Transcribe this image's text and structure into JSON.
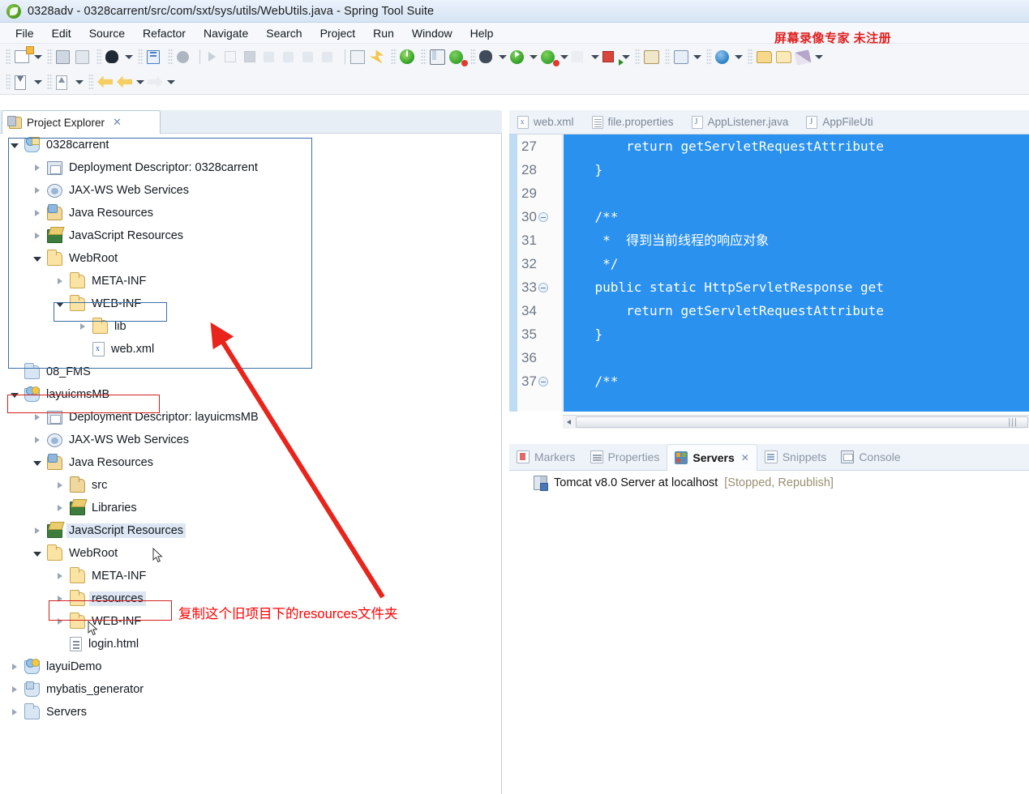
{
  "window": {
    "title": "0328adv - 0328carrent/src/com/sxt/sys/utils/WebUtils.java - Spring Tool Suite",
    "logo_icon": "spring-logo-icon"
  },
  "menubar": {
    "items": [
      {
        "label": "File"
      },
      {
        "label": "Edit"
      },
      {
        "label": "Source"
      },
      {
        "label": "Refactor"
      },
      {
        "label": "Navigate"
      },
      {
        "label": "Search"
      },
      {
        "label": "Project"
      },
      {
        "label": "Run"
      },
      {
        "label": "Window"
      },
      {
        "label": "Help"
      }
    ]
  },
  "watermark": {
    "text": "屏幕录像专家 未注册",
    "color": "#e02020"
  },
  "project_explorer": {
    "tab_label": "Project Explorer",
    "tab_close": "✕",
    "toolbar": [
      {
        "icon": "collapse-all-icon"
      },
      {
        "icon": "link-with-editor-icon"
      },
      {
        "icon": "view-menu-dim-icon"
      },
      {
        "icon": "view-menu-icon"
      },
      {
        "icon": "minimize-icon"
      },
      {
        "icon": "maximize-icon"
      }
    ],
    "tree": [
      {
        "label": "0328carrent",
        "depth": 0,
        "twisty": "open",
        "icon": "project-icon"
      },
      {
        "label": "Deployment Descriptor: 0328carrent",
        "depth": 1,
        "twisty": "closed",
        "icon": "deployment-descriptor-icon"
      },
      {
        "label": "JAX-WS Web Services",
        "depth": 1,
        "twisty": "closed",
        "icon": "jaxws-icon"
      },
      {
        "label": "Java Resources",
        "depth": 1,
        "twisty": "closed",
        "icon": "java-resources-icon"
      },
      {
        "label": "JavaScript Resources",
        "depth": 1,
        "twisty": "closed",
        "icon": "javascript-resources-icon"
      },
      {
        "label": "WebRoot",
        "depth": 1,
        "twisty": "open",
        "icon": "folder-icon"
      },
      {
        "label": "META-INF",
        "depth": 2,
        "twisty": "closed",
        "icon": "folder-icon"
      },
      {
        "label": "WEB-INF",
        "depth": 2,
        "twisty": "open",
        "icon": "folder-icon"
      },
      {
        "label": "lib",
        "depth": 3,
        "twisty": "closed",
        "icon": "folder-icon"
      },
      {
        "label": "web.xml",
        "depth": 3,
        "twisty": "none",
        "icon": "xml-file-icon"
      },
      {
        "label": "08_FMS",
        "depth": 0,
        "twisty": "none",
        "icon": "folder-plain-icon"
      },
      {
        "label": "layuicmsMB",
        "depth": 0,
        "twisty": "open",
        "icon": "project-warning-icon"
      },
      {
        "label": "Deployment Descriptor: layuicmsMB",
        "depth": 1,
        "twisty": "closed",
        "icon": "deployment-descriptor-icon"
      },
      {
        "label": "JAX-WS Web Services",
        "depth": 1,
        "twisty": "closed",
        "icon": "jaxws-icon"
      },
      {
        "label": "Java Resources",
        "depth": 1,
        "twisty": "open",
        "icon": "java-resources-icon"
      },
      {
        "label": "src",
        "depth": 2,
        "twisty": "closed",
        "icon": "source-folder-icon"
      },
      {
        "label": "Libraries",
        "depth": 2,
        "twisty": "closed",
        "icon": "javascript-resources-icon"
      },
      {
        "label": "JavaScript Resources",
        "depth": 1,
        "twisty": "closed",
        "icon": "javascript-resources-icon",
        "selected": true
      },
      {
        "label": "WebRoot",
        "depth": 1,
        "twisty": "open",
        "icon": "folder-icon"
      },
      {
        "label": "META-INF",
        "depth": 2,
        "twisty": "closed",
        "icon": "folder-icon"
      },
      {
        "label": "resources",
        "depth": 2,
        "twisty": "closed",
        "icon": "folder-icon",
        "selected": true
      },
      {
        "label": "WEB-INF",
        "depth": 2,
        "twisty": "closed",
        "icon": "folder-icon"
      },
      {
        "label": "login.html",
        "depth": 2,
        "twisty": "none",
        "icon": "html-file-icon"
      },
      {
        "label": "layuiDemo",
        "depth": 0,
        "twisty": "closed",
        "icon": "project-warning-icon"
      },
      {
        "label": "mybatis_generator",
        "depth": 0,
        "twisty": "closed",
        "icon": "mybatis-project-icon"
      },
      {
        "label": "Servers",
        "depth": 0,
        "twisty": "closed",
        "icon": "servers-folder-icon"
      }
    ]
  },
  "annotations": {
    "note_text": "复制这个旧项目下的resources文件夹",
    "note_color": "#ff0000",
    "blue_box_color": "#3a6ea5",
    "red_box_color": "#d21f1f",
    "arrow_color": "#e8241b"
  },
  "editor": {
    "tabs": [
      {
        "label": "web.xml",
        "icon": "xml-file-icon"
      },
      {
        "label": "file.properties",
        "icon": "properties-file-icon"
      },
      {
        "label": "AppListener.java",
        "icon": "java-file-icon"
      },
      {
        "label": "AppFileUti",
        "icon": "java-file-icon"
      }
    ],
    "line_numbers": [
      "27",
      "28",
      "29",
      "30",
      "31",
      "32",
      "33",
      "34",
      "35",
      "36",
      "37"
    ],
    "folds": [
      "",
      "",
      "",
      "fold",
      "",
      "",
      "fold",
      "",
      "",
      "",
      "fold"
    ],
    "code_lines": [
      "        return getServletRequestAttribute",
      "    }",
      "",
      "    /**",
      "     *  得到当前线程的响应对象",
      "     */",
      "    public static HttpServletResponse get",
      "        return getServletRequestAttribute",
      "    }",
      "",
      "    /**"
    ],
    "selection_color": "#2a91ef",
    "scroll_grip": "|||"
  },
  "bottom_view": {
    "tabs": [
      {
        "label": "Markers",
        "icon": "markers-icon",
        "active": false
      },
      {
        "label": "Properties",
        "icon": "properties-icon",
        "active": false
      },
      {
        "label": "Servers",
        "icon": "servers-icon",
        "active": true,
        "close": "✕"
      },
      {
        "label": "Snippets",
        "icon": "snippets-icon",
        "active": false
      },
      {
        "label": "Console",
        "icon": "console-icon",
        "active": false
      }
    ],
    "server": {
      "name": "Tomcat v8.0 Server at localhost",
      "status": "[Stopped, Republish]",
      "icon": "server-icon"
    }
  }
}
